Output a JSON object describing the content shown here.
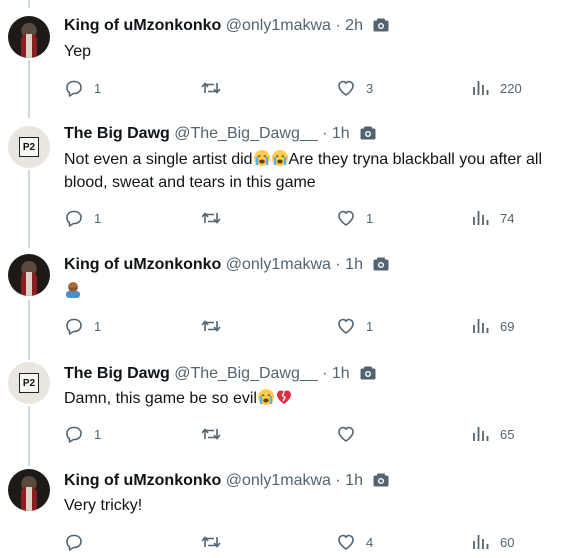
{
  "tweets": [
    {
      "avatar": "king-avatar",
      "name": "King of uMzonkonko",
      "handle": "@only1makwa",
      "time": "· 2h",
      "text": "Yep",
      "replies": "1",
      "likes": "3",
      "views": "220"
    },
    {
      "avatar": "p2-avatar",
      "name": "The Big Dawg",
      "handle": "@The_Big_Dawg__",
      "time": "· 1h",
      "text_part1": "Not even a single artist did",
      "emoji": [
        "loudly-crying-face",
        "loudly-crying-face"
      ],
      "text_part2": "Are they tryna blackball you after all",
      "text_line2": "blood, sweat and tears in this game",
      "replies": "1",
      "likes": "1",
      "views": "74"
    },
    {
      "avatar": "king-avatar",
      "name": "King of uMzonkonko",
      "handle": "@only1makwa",
      "time": "· 1h",
      "emoji": [
        "man-facepalming"
      ],
      "replies": "1",
      "likes": "1",
      "views": "69"
    },
    {
      "avatar": "p2-avatar",
      "name": "The Big Dawg",
      "handle": "@The_Big_Dawg__",
      "time": "· 1h",
      "text": "Damn, this game be so evil",
      "emoji": [
        "loudly-crying-face",
        "broken-heart"
      ],
      "replies": "1",
      "likes": "",
      "views": "65"
    },
    {
      "avatar": "king-avatar",
      "name": "King of uMzonkonko",
      "handle": "@only1makwa",
      "time": "· 1h",
      "text": "Very tricky!",
      "replies": "",
      "likes": "4",
      "views": "60"
    }
  ],
  "colors": {
    "text": "#0f1419",
    "muted": "#536471",
    "thread_line": "#cfd9de"
  }
}
